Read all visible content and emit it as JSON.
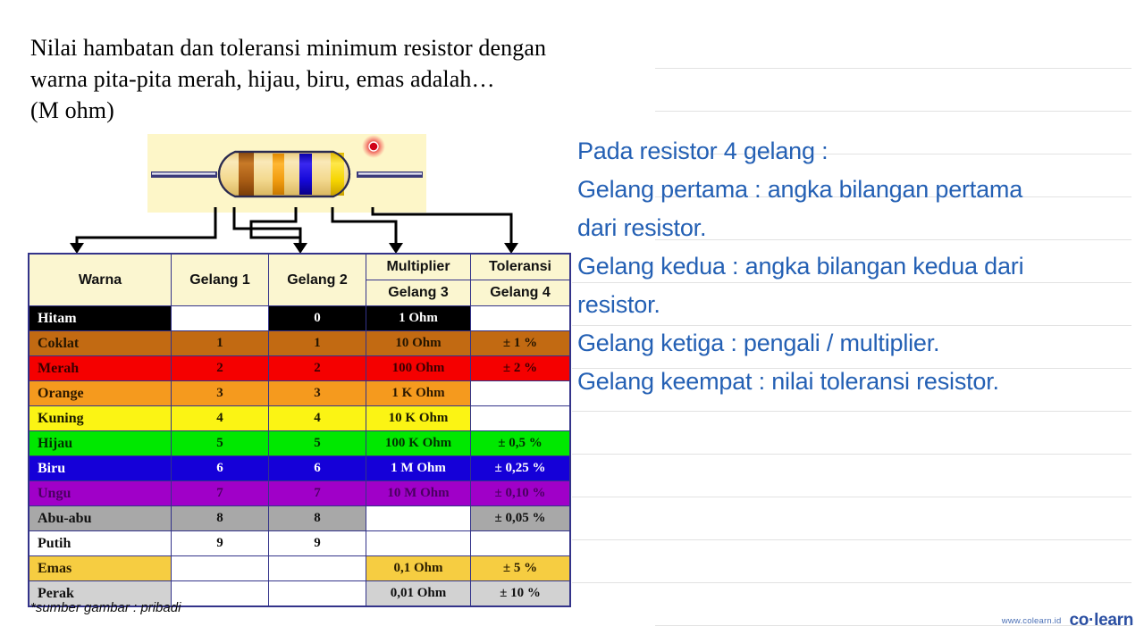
{
  "question": {
    "lines": [
      "Nilai hambatan dan toleransi minimum resistor dengan",
      "warna pita-pita merah, hijau, biru, emas adalah…",
      "(M ohm)"
    ]
  },
  "figure": {
    "alt": "resistor-4-band-diagram",
    "bands": [
      "coklat",
      "orange",
      "biru",
      "emas"
    ],
    "band_colors": [
      "#b5651d",
      "#f5a000",
      "#1500d8",
      "#f5d000"
    ],
    "background": "#fdf6c8",
    "pointer_dot_color": "#e01020"
  },
  "table": {
    "header_top": [
      "Warna",
      "Gelang 1",
      "Gelang 2",
      "Multiplier",
      "Toleransi"
    ],
    "header_sub": [
      "Gelang 3",
      "Gelang 4"
    ],
    "rows": [
      {
        "warna": "Hitam",
        "g1": "",
        "g2": "0",
        "g3": "1 Ohm",
        "g4": "",
        "bg": "#000000",
        "fg": "#ffffff",
        "g1_empty": true,
        "g4_empty": true
      },
      {
        "warna": "Coklat",
        "g1": "1",
        "g2": "1",
        "g3": "10 Ohm",
        "g4": "± 1 %",
        "bg": "#c26a12",
        "fg": "#241500",
        "g1_empty": false,
        "g4_empty": false
      },
      {
        "warna": "Merah",
        "g1": "2",
        "g2": "2",
        "g3": "100 Ohm",
        "g4": "± 2 %",
        "bg": "#f50000",
        "fg": "#3a0000",
        "g1_empty": false,
        "g4_empty": false
      },
      {
        "warna": "Orange",
        "g1": "3",
        "g2": "3",
        "g3": "1 K Ohm",
        "g4": "",
        "bg": "#f59a1e",
        "fg": "#2b1800",
        "g1_empty": false,
        "g4_empty": true
      },
      {
        "warna": "Kuning",
        "g1": "4",
        "g2": "4",
        "g3": "10 K Ohm",
        "g4": "",
        "bg": "#fbf414",
        "fg": "#1a1a00",
        "g1_empty": false,
        "g4_empty": true
      },
      {
        "warna": "Hijau",
        "g1": "5",
        "g2": "5",
        "g3": "100 K Ohm",
        "g4": "± 0,5 %",
        "bg": "#00e800",
        "fg": "#003000",
        "g1_empty": false,
        "g4_empty": false
      },
      {
        "warna": "Biru",
        "g1": "6",
        "g2": "6",
        "g3": "1 M Ohm",
        "g4": "± 0,25 %",
        "bg": "#1500d8",
        "fg": "#ffffff",
        "g1_empty": false,
        "g4_empty": false
      },
      {
        "warna": "Ungu",
        "g1": "7",
        "g2": "7",
        "g3": "10 M Ohm",
        "g4": "± 0,10 %",
        "bg": "#a000c8",
        "fg": "#4a0060",
        "g1_empty": false,
        "g4_empty": false
      },
      {
        "warna": "Abu-abu",
        "g1": "8",
        "g2": "8",
        "g3": "",
        "g4": "± 0,05 %",
        "bg": "#a8a8a8",
        "fg": "#101010",
        "g1_empty": false,
        "g3_empty": true,
        "g4_empty": false
      },
      {
        "warna": "Putih",
        "g1": "9",
        "g2": "9",
        "g3": "",
        "g4": "",
        "bg": "#ffffff",
        "fg": "#101010",
        "g1_empty": false,
        "g3_empty": true,
        "g4_empty": true
      },
      {
        "warna": "Emas",
        "g1": "",
        "g2": "",
        "g3": "0,1 Ohm",
        "g4": "± 5 %",
        "bg": "#f6cd41",
        "fg": "#2a1d00",
        "g1_empty": true,
        "g2_empty": true,
        "g4_empty": false
      },
      {
        "warna": "Perak",
        "g1": "",
        "g2": "",
        "g3": "0,01 Ohm",
        "g4": "± 10 %",
        "bg": "#d2d2d2",
        "fg": "#101010",
        "g1_empty": true,
        "g2_empty": true,
        "g4_empty": false
      }
    ]
  },
  "annotations": {
    "lines": [
      "Pada resistor 4 gelang :",
      "Gelang pertama : angka bilangan pertama",
      "dari resistor.",
      "Gelang kedua : angka bilangan kedua dari",
      "resistor.",
      "Gelang ketiga : pengali / multiplier.",
      "Gelang keempat : nilai toleransi resistor."
    ],
    "color": "#2460b4"
  },
  "footer": {
    "source_note": "*sumber gambar : pribadi",
    "brand_url": "www.colearn.id",
    "brand_name": "co·learn"
  }
}
